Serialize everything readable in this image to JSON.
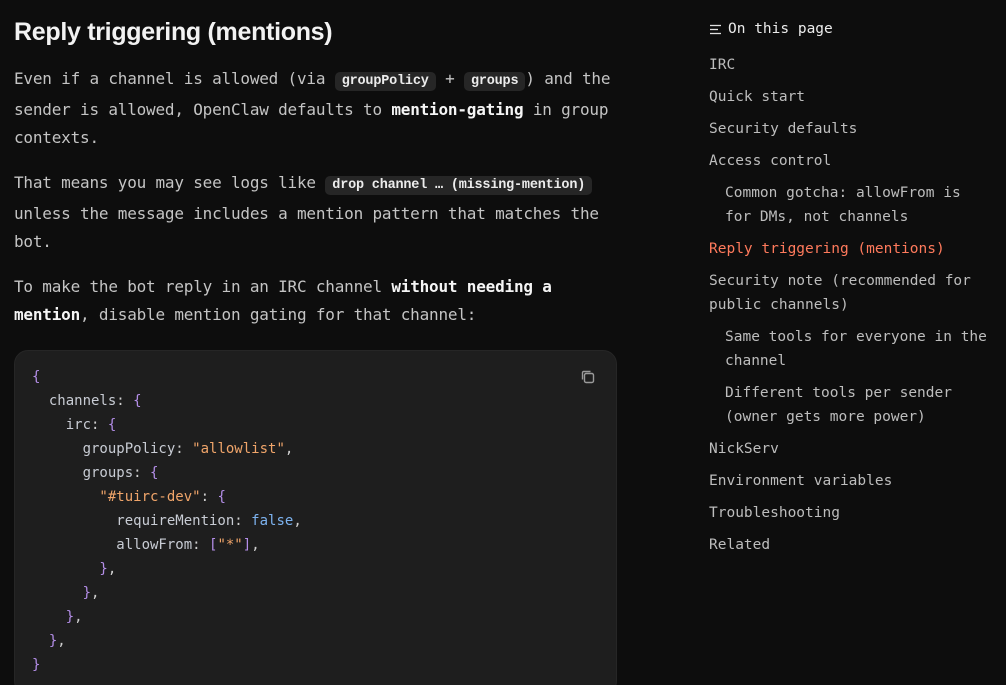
{
  "article": {
    "heading": "Reply triggering (mentions)",
    "p1": {
      "t1": "Even if a channel is allowed (via ",
      "code1": "groupPolicy",
      "t2": " + ",
      "code2": "groups",
      "t3": ") and the sender is allowed, OpenClaw defaults to ",
      "bold": "mention-gating",
      "t4": " in group contexts."
    },
    "p2": {
      "t1": "That means you may see logs like ",
      "code": "drop channel … (missing-mention)",
      "t2": " unless the message includes a mention pattern that matches the bot."
    },
    "p3": {
      "t1": "To make the bot reply in an IRC channel ",
      "bold": "without needing a mention",
      "t2": ", disable mention gating for that channel:"
    }
  },
  "code_block": {
    "lines": [
      [
        [
          "p",
          "{"
        ]
      ],
      [
        [
          "k",
          "  channels"
        ],
        [
          "d",
          ": "
        ],
        [
          "p",
          "{"
        ]
      ],
      [
        [
          "k",
          "    irc"
        ],
        [
          "d",
          ": "
        ],
        [
          "p",
          "{"
        ]
      ],
      [
        [
          "k",
          "      groupPolicy"
        ],
        [
          "d",
          ": "
        ],
        [
          "s",
          "\"allowlist\""
        ],
        [
          "d",
          ","
        ]
      ],
      [
        [
          "k",
          "      groups"
        ],
        [
          "d",
          ": "
        ],
        [
          "p",
          "{"
        ]
      ],
      [
        [
          "s",
          "        \"#tuirc-dev\""
        ],
        [
          "d",
          ": "
        ],
        [
          "p",
          "{"
        ]
      ],
      [
        [
          "k",
          "          requireMention"
        ],
        [
          "d",
          ": "
        ],
        [
          "b",
          "false"
        ],
        [
          "d",
          ","
        ]
      ],
      [
        [
          "k",
          "          allowFrom"
        ],
        [
          "d",
          ": "
        ],
        [
          "p",
          "["
        ],
        [
          "s",
          "\"*\""
        ],
        [
          "p",
          "]"
        ],
        [
          "d",
          ","
        ]
      ],
      [
        [
          "p",
          "        }"
        ],
        [
          "d",
          ","
        ]
      ],
      [
        [
          "p",
          "      }"
        ],
        [
          "d",
          ","
        ]
      ],
      [
        [
          "p",
          "    }"
        ],
        [
          "d",
          ","
        ]
      ],
      [
        [
          "p",
          "  }"
        ],
        [
          "d",
          ","
        ]
      ],
      [
        [
          "p",
          "}"
        ]
      ]
    ]
  },
  "toc": {
    "title": "On this page",
    "items": [
      {
        "label": "IRC",
        "level": 1
      },
      {
        "label": "Quick start",
        "level": 1
      },
      {
        "label": "Security defaults",
        "level": 1
      },
      {
        "label": "Access control",
        "level": 1
      },
      {
        "label": "Common gotcha: allowFrom is for DMs, not channels",
        "level": 2
      },
      {
        "label": "Reply triggering (mentions)",
        "level": 1,
        "active": true
      },
      {
        "label": "Security note (recommended for public channels)",
        "level": 1
      },
      {
        "label": "Same tools for everyone in the channel",
        "level": 2
      },
      {
        "label": "Different tools per sender (owner gets more power)",
        "level": 2
      },
      {
        "label": "NickServ",
        "level": 1
      },
      {
        "label": "Environment variables",
        "level": 1
      },
      {
        "label": "Troubleshooting",
        "level": 1
      },
      {
        "label": "Related",
        "level": 1
      }
    ]
  },
  "colors": {
    "accent": "#ff7a5c",
    "background": "#0d0d0d",
    "code_background": "#1e1e1e"
  }
}
